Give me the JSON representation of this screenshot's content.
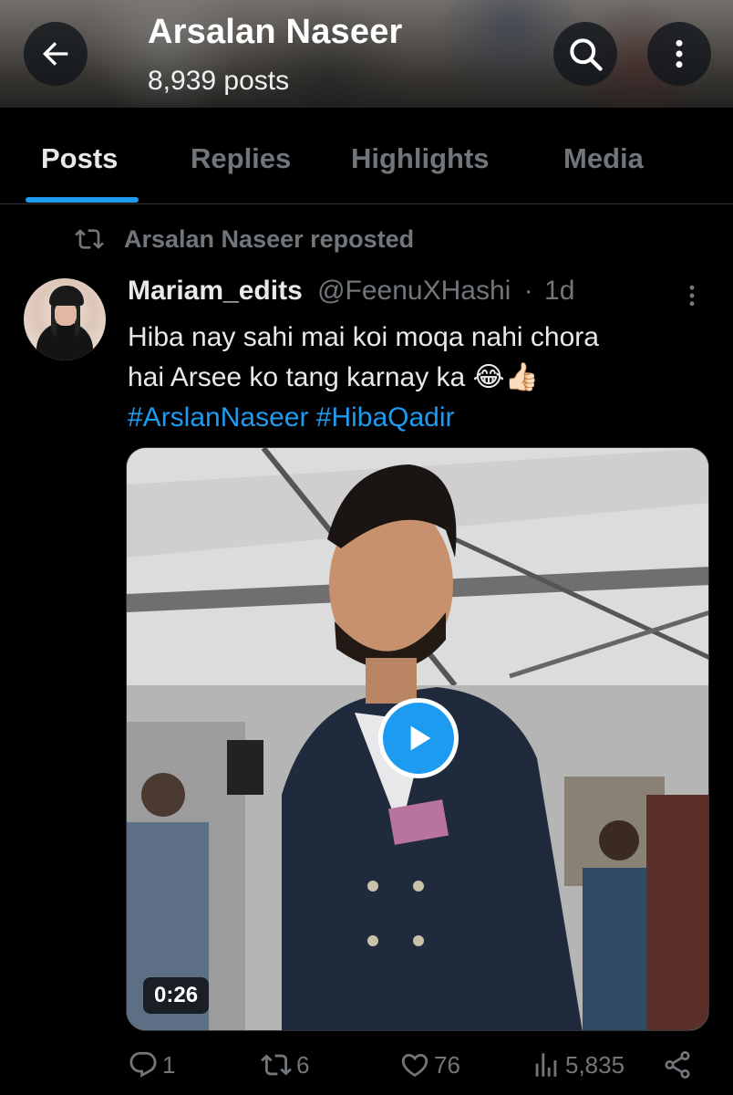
{
  "header": {
    "title": "Arsalan Naseer",
    "subtitle": "8,939 posts",
    "back_icon": "arrow-left-icon",
    "search_icon": "search-icon",
    "more_icon": "more-vertical-icon"
  },
  "tabs": [
    {
      "label": "Posts",
      "active": true
    },
    {
      "label": "Replies",
      "active": false
    },
    {
      "label": "Highlights",
      "active": false
    },
    {
      "label": "Media",
      "active": false
    }
  ],
  "repost": {
    "icon": "repost-icon",
    "text": "Arsalan Naseer reposted"
  },
  "tweet": {
    "display_name": "Mariam_edits",
    "handle": "@FeenuXHashi",
    "separator": "·",
    "time": "1d",
    "text_line1": "Hiba nay sahi mai koi moqa nahi chora",
    "text_line2": "hai Arsee ko tang karnay ka 😂👍🏻",
    "hashtag1": "#ArslanNaseer",
    "hashtag2": "#HibaQadir",
    "media": {
      "type": "video",
      "duration": "0:26"
    },
    "actions": {
      "replies": "1",
      "reposts": "6",
      "likes": "76",
      "views": "5,835"
    }
  },
  "colors": {
    "accent": "#1d9bf0",
    "muted": "#71767b",
    "text": "#e7e9ea",
    "background": "#000000"
  }
}
